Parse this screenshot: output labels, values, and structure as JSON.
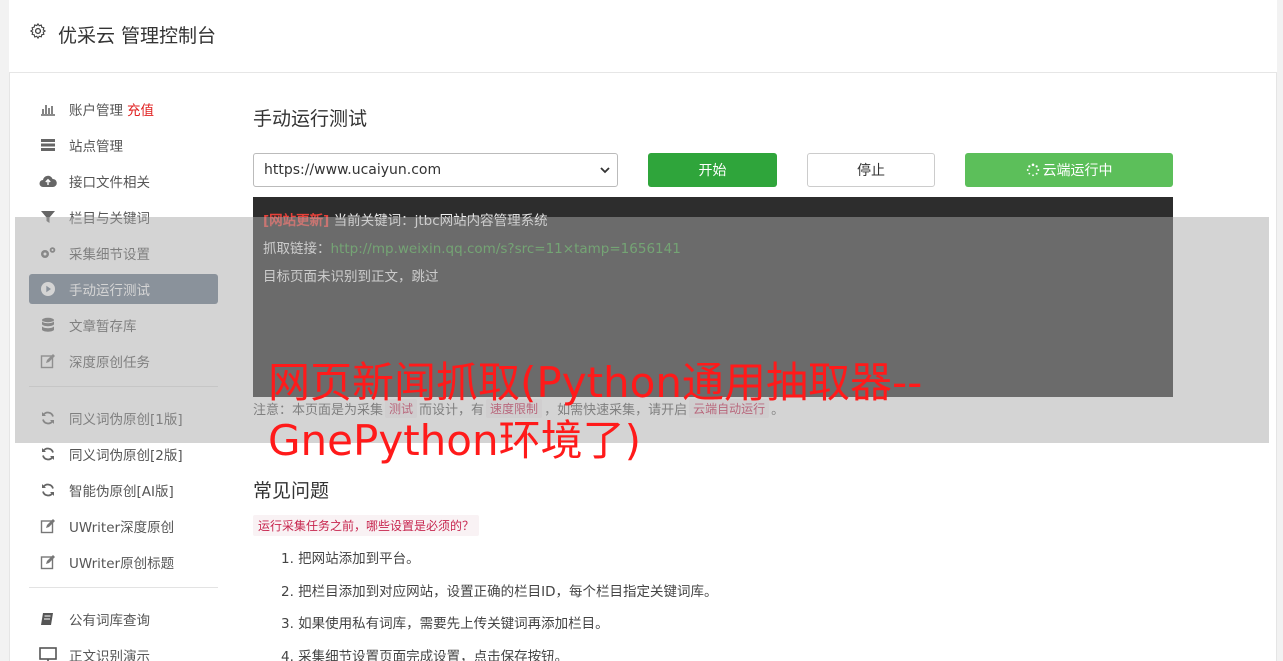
{
  "header": {
    "title": "优采云 管理控制台"
  },
  "sidebar": {
    "group1": [
      {
        "label": "账户管理",
        "extra": "充值",
        "icon": "bar-chart-icon"
      },
      {
        "label": "站点管理",
        "icon": "server-icon"
      },
      {
        "label": "接口文件相关",
        "icon": "cloud-upload-icon"
      },
      {
        "label": "栏目与关键词",
        "icon": "filter-icon"
      },
      {
        "label": "采集细节设置",
        "icon": "gears-icon"
      },
      {
        "label": "手动运行测试",
        "icon": "play-circle-icon",
        "active": true
      },
      {
        "label": "文章暂存库",
        "icon": "database-icon"
      },
      {
        "label": "深度原创任务",
        "icon": "edit-icon"
      }
    ],
    "group2": [
      {
        "label": "同义词伪原创[1版]",
        "icon": "refresh-icon"
      },
      {
        "label": "同义词伪原创[2版]",
        "icon": "refresh-icon"
      },
      {
        "label": "智能伪原创[AI版]",
        "icon": "refresh-icon"
      },
      {
        "label": "UWriter深度原创",
        "icon": "edit-icon"
      },
      {
        "label": "UWriter原创标题",
        "icon": "edit-icon"
      }
    ],
    "group3": [
      {
        "label": "公有词库查询",
        "icon": "book-icon"
      },
      {
        "label": "正文识别演示",
        "icon": "monitor-icon"
      }
    ]
  },
  "main": {
    "title": "手动运行测试",
    "url_select_value": "https://www.ucaiyun.com",
    "start_label": "开始",
    "stop_label": "停止",
    "cloud_label": "云端运行中",
    "console": {
      "line1_tag": "[网站更新]",
      "line1_text": " 当前关键词：jtbc网站内容管理系统",
      "line2_label": "抓取链接：",
      "line2_link": "http://mp.weixin.qq.com/s?src=11×tamp=1656141",
      "line3_text": "目标页面未识别到正文，跳过"
    },
    "notice": {
      "prefix": "注意：本页面是为采集",
      "code1": "测试",
      "mid1": "而设计，有",
      "code2": "速度限制",
      "mid2": "，如需快速采集，请开启",
      "code3": "云端自动运行",
      "suffix": "。"
    },
    "faq": {
      "title": "常见问题",
      "question": "运行采集任务之前，哪些设置是必须的？",
      "items": [
        "1. 把网站添加到平台。",
        "2. 把栏目添加到对应网站，设置正确的栏目ID，每个栏目指定关键词库。",
        "3. 如果使用私有词库，需要先上传关键词再添加栏目。",
        "4. 采集细节设置页面完成设置，点击保存按钮。"
      ]
    }
  },
  "overlay_headline": "网页新闻抓取(Python通用抽取器--GnePython环境了)",
  "colors": {
    "active_nav": "#6b7a8c",
    "start_button": "#2fa53b",
    "cloud_button": "#5cbf5a",
    "console_bg": "#2d2d2d",
    "headline": "#ff1a1a"
  }
}
